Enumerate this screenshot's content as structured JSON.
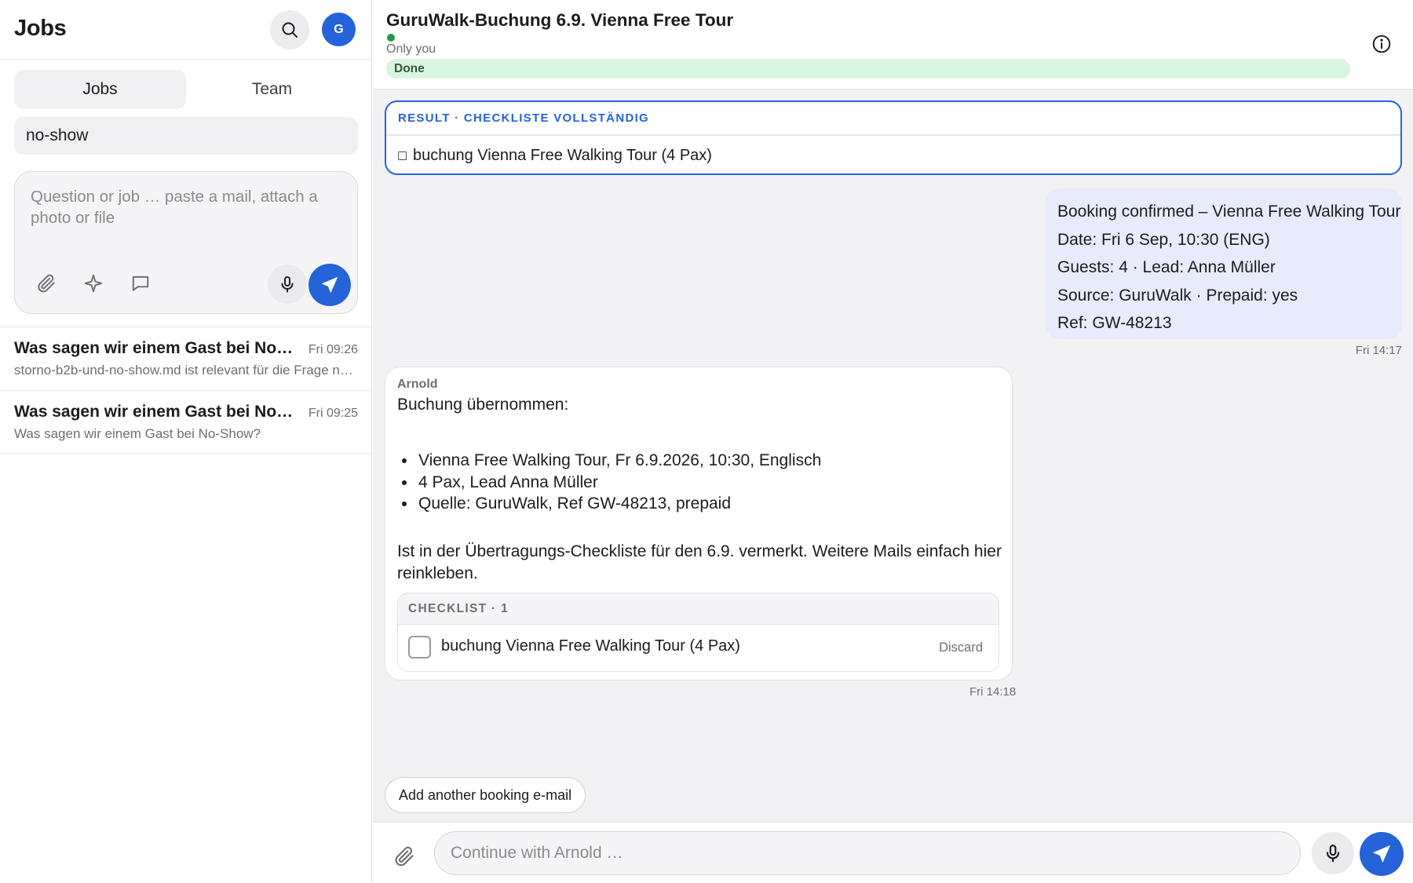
{
  "sidebar": {
    "title": "Jobs",
    "avatar_initial": "G",
    "tabs": [
      {
        "label": "Jobs",
        "active": true
      },
      {
        "label": "Team",
        "active": false
      }
    ],
    "filter_value": "no-show",
    "composer": {
      "placeholder": "Question or job … paste a mail, attach a photo or file"
    },
    "jobs": [
      {
        "title": "Was sagen wir einem Gast bei No-Show?",
        "time": "Fri 09:26",
        "subtitle": "storno-b2b-und-no-show.md ist relevant für die Frage nach No-Show"
      },
      {
        "title": "Was sagen wir einem Gast bei No-Show?",
        "time": "Fri 09:25",
        "subtitle": "Was sagen wir einem Gast bei No-Show?"
      }
    ]
  },
  "main": {
    "title": "GuruWalk-Buchung 6.9. Vienna Free Tour",
    "visibility": "Only you",
    "status": "Done",
    "result": {
      "label": "RESULT · CHECKLISTE VOLLSTÄNDIG",
      "item": "buchung Vienna Free Walking Tour (4 Pax)"
    },
    "user_message": {
      "lines": [
        "Booking confirmed – Vienna Free Walking Tour",
        "Date: Fri 6 Sep, 10:30 (ENG)",
        "Guests: 4 · Lead: Anna Müller",
        "Source: GuruWalk · Prepaid: yes",
        "Ref: GW-48213"
      ],
      "time": "Fri 14:17"
    },
    "bot_message": {
      "author": "Arnold",
      "intro": "Buchung übernommen:",
      "bullets": [
        "Vienna Free Walking Tour, Fr 6.9.2026, 10:30, Englisch",
        "4 Pax, Lead Anna Müller",
        "Quelle: GuruWalk, Ref GW-48213, prepaid"
      ],
      "paragraph": "Ist in der Übertragungs-Checkliste für den 6.9. vermerkt. Weitere Mails einfach hier reinkleben.",
      "checklist": {
        "header": "CHECKLIST · 1",
        "item": "buchung Vienna Free Walking Tour (4 Pax)",
        "discard_label": "Discard"
      },
      "time": "Fri 14:18"
    },
    "suggestion": "Add another booking e-mail",
    "footer": {
      "placeholder": "Continue with Arnold …"
    }
  },
  "icons": {
    "search": "search-icon",
    "paperclip": "paperclip-icon",
    "sparkle": "sparkle-icon",
    "chat": "chat-bubble-icon",
    "mic": "microphone-icon",
    "send": "send-icon",
    "info": "info-icon"
  },
  "colors": {
    "accent": "#2563d9",
    "status_bg": "#daf5df",
    "status_dot": "#1e9e4a",
    "user_bubble": "#e7ebfb"
  }
}
